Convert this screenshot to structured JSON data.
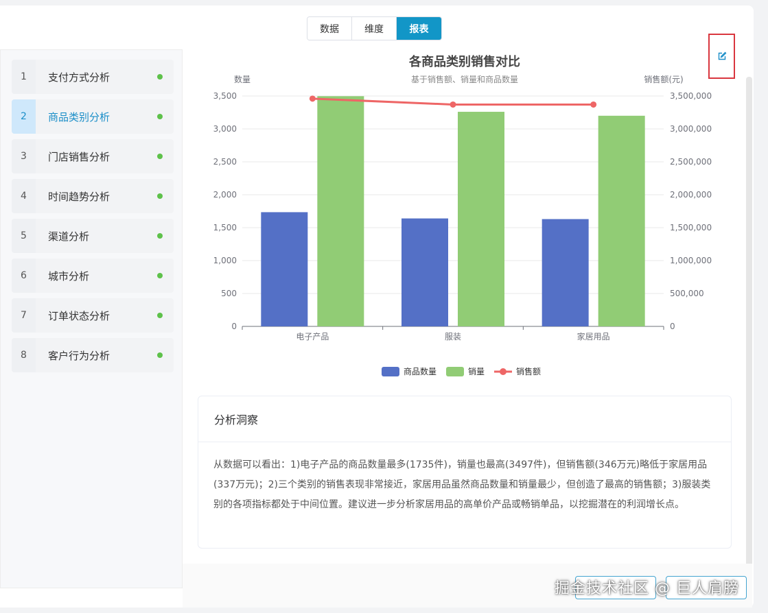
{
  "view_tabs": [
    {
      "label": "数据"
    },
    {
      "label": "维度"
    },
    {
      "label": "报表"
    }
  ],
  "active_tab": "报表",
  "sidebar": {
    "items": [
      {
        "num": "1",
        "label": "支付方式分析"
      },
      {
        "num": "2",
        "label": "商品类别分析"
      },
      {
        "num": "3",
        "label": "门店销售分析"
      },
      {
        "num": "4",
        "label": "时间趋势分析"
      },
      {
        "num": "5",
        "label": "渠道分析"
      },
      {
        "num": "6",
        "label": "城市分析"
      },
      {
        "num": "7",
        "label": "订单状态分析"
      },
      {
        "num": "8",
        "label": "客户行为分析"
      }
    ],
    "active_index": 1,
    "status_color": "#5ec14a"
  },
  "edit_icon": "edit-icon",
  "chart_data": {
    "type": "bar",
    "title": "各商品类别销售对比",
    "subtitle": "基于销售额、销量和商品数量",
    "ylabel_left": "数量",
    "ylabel_right": "销售额(元)",
    "categories": [
      "电子产品",
      "服装",
      "家居用品"
    ],
    "ylim_left": [
      0,
      3500
    ],
    "ylim_right": [
      0,
      3500000
    ],
    "yticks_left": [
      "0",
      "500",
      "1,000",
      "1,500",
      "2,000",
      "2,500",
      "3,000",
      "3,500"
    ],
    "yticks_right": [
      "0",
      "500,000",
      "1,000,000",
      "1,500,000",
      "2,000,000",
      "2,500,000",
      "3,000,000",
      "3,500,000"
    ],
    "series": [
      {
        "name": "商品数量",
        "type": "bar",
        "axis": "left",
        "color": "#5470c6",
        "values": [
          1735,
          1640,
          1630
        ]
      },
      {
        "name": "销量",
        "type": "bar",
        "axis": "left",
        "color": "#91cc75",
        "values": [
          3497,
          3260,
          3200
        ]
      },
      {
        "name": "销售额",
        "type": "line",
        "axis": "right",
        "color": "#ee6666",
        "values": [
          3460000,
          3370000,
          3370000
        ]
      }
    ],
    "legend_position": "bottom"
  },
  "insight": {
    "title": "分析洞察",
    "text": "从数据可以看出：1)电子产品的商品数量最多(1735件)，销量也最高(3497件)，但销售额(346万元)略低于家居用品(337万元)；2)三个类别的销售表现非常接近，家居用品虽然商品数量和销量最少，但创造了最高的销售额；3)服装类别的各项指标都处于中间位置。建议进一步分析家居用品的高单价产品或畅销单品，以挖掘潜在的利润增长点。"
  },
  "watermark": "掘金技术社区 @ 巨人肩膀",
  "accent_color": "#1296c7"
}
